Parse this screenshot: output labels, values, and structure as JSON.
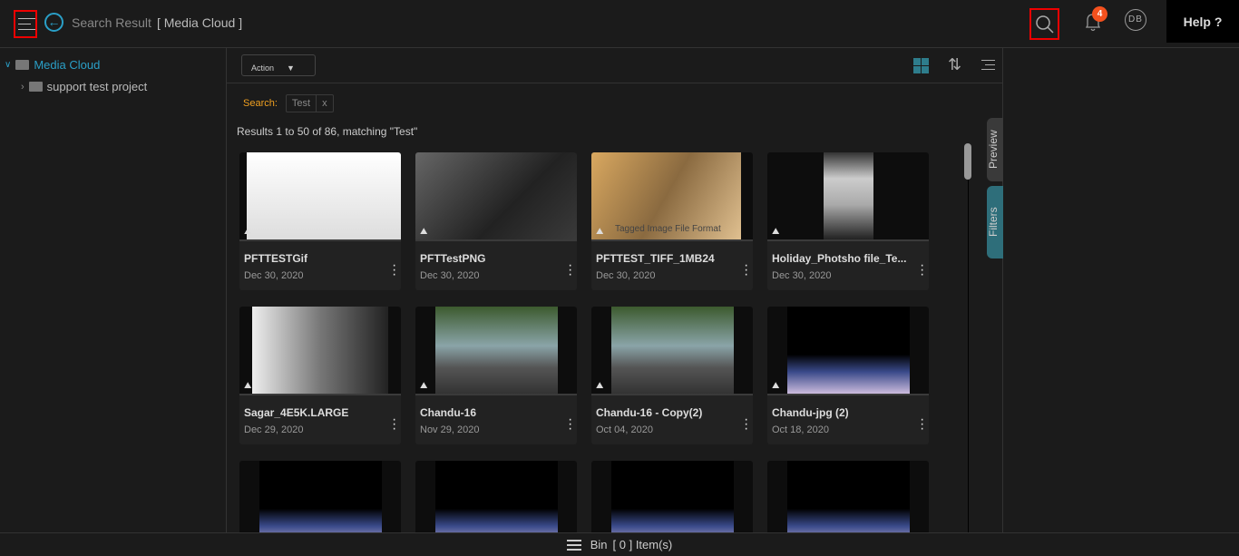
{
  "header": {
    "breadcrumb": "Search Result",
    "location": "[ Media Cloud ]",
    "notification_count": "4",
    "avatar_initials": "DB",
    "help_label": "Help ?"
  },
  "sidebar": {
    "root": "Media Cloud",
    "children": [
      "support test project"
    ]
  },
  "toolbar": {
    "action_label": "Action"
  },
  "search": {
    "label": "Search:",
    "term": "Test",
    "clear": "x"
  },
  "results_text": "Results 1 to 50 of 86, matching \"Test\"",
  "side_tabs": {
    "preview": "Preview",
    "filters": "Filters"
  },
  "colors": {
    "accent": "#2a9fc7",
    "badge": "#f4511e",
    "search_label": "#f0a020",
    "filters_tab": "#2e6e7a"
  },
  "cards": [
    {
      "name": "PFTTESTGif",
      "date": "Dec 30, 2020"
    },
    {
      "name": "PFTTestPNG",
      "date": "Dec 30, 2020"
    },
    {
      "name": "PFTTEST_TIFF_1MB24",
      "date": "Dec 30, 2020",
      "caption": "Tagged Image File Format"
    },
    {
      "name": "Holiday_Photsho file_Te...",
      "date": "Dec 30, 2020"
    },
    {
      "name": "Sagar_4E5K.LARGE",
      "date": "Dec 29, 2020"
    },
    {
      "name": "Chandu-16",
      "date": "Nov 29, 2020"
    },
    {
      "name": "Chandu-16 - Copy(2)",
      "date": "Oct 04, 2020"
    },
    {
      "name": "Chandu-jpg (2)",
      "date": "Oct 18, 2020"
    }
  ],
  "bottom": {
    "bin_label": "Bin",
    "bin_count": "[ 0 ] Item(s)"
  }
}
